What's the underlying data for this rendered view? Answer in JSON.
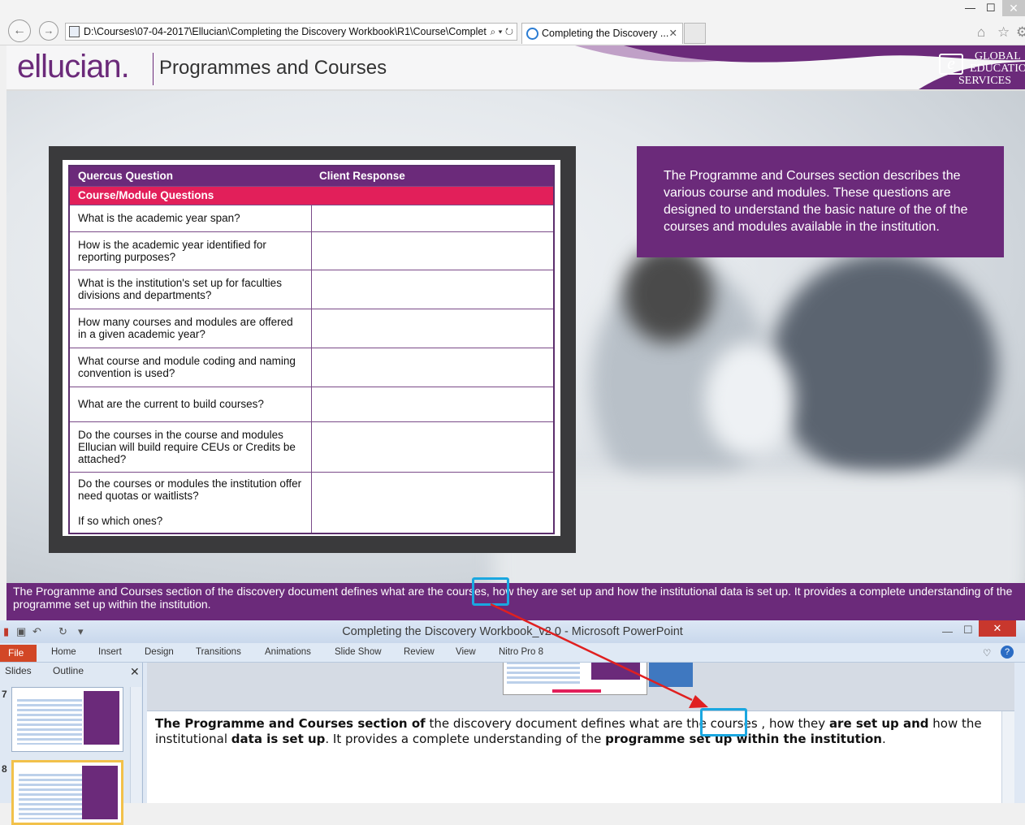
{
  "browser": {
    "address": "D:\\Courses\\07-04-2017\\Ellucian\\Completing the Discovery Workbook\\R1\\Course\\Complet",
    "addr_tools": "⌕ ▾ ↻",
    "tab_title": "Completing the Discovery ...",
    "tab_close": "✕",
    "back": "←",
    "forward": "→",
    "minimize": "—",
    "maximize": "☐",
    "close": "✕",
    "home": "⌂",
    "star": "☆",
    "settings": "⚙"
  },
  "slide": {
    "logo": "ellucian.",
    "title": "Programmes and Courses",
    "partner_logo": {
      "mark": "e",
      "line1": "GLOBAL",
      "line2": "EDUCATIO",
      "line3": "SERVICES"
    }
  },
  "table": {
    "headers": [
      "Quercus Question",
      "Client Response"
    ],
    "category": "Course/Module Questions",
    "rows": [
      {
        "q": "What is the academic year span?",
        "a": ""
      },
      {
        "q": "How is the academic year identified for reporting purposes?",
        "a": ""
      },
      {
        "q": "What is the institution's set up for faculties divisions and departments?",
        "a": ""
      },
      {
        "q": "How many courses and modules are offered in a given academic year?",
        "a": ""
      },
      {
        "q": "What course and module coding and naming convention is used?",
        "a": ""
      },
      {
        "q": "What are the current to build courses?",
        "a": ""
      },
      {
        "q": "Do the courses in the course and modules Ellucian will build require CEUs or Credits be attached?",
        "a": ""
      },
      {
        "q": "Do the courses or modules the institution offer need quotas or waitlists?",
        "q2": "If so which ones?",
        "a": ""
      }
    ]
  },
  "info_box": "The Programme and Courses section describes the various course and modules. These questions are designed to understand the basic nature of the of the courses and modules available in the institution.",
  "caption": "The Programme and Courses section of the discovery document defines what are the courses, how they are set up and how the institutional data is set up. It provides a complete understanding of the programme set up within the institution.",
  "powerpoint": {
    "window_title": "Completing the Discovery Workbook_v2.0 - Microsoft PowerPoint",
    "minimize": "—",
    "maximize": "☐",
    "close": "✕",
    "tabs": [
      "File",
      "Home",
      "Insert",
      "Design",
      "Transitions",
      "Animations",
      "Slide Show",
      "Review",
      "View",
      "Nitro Pro 8"
    ],
    "pane_tabs": [
      "Slides",
      "Outline"
    ],
    "pane_close": "✕",
    "slide_numbers": [
      "7",
      "8"
    ],
    "notes": {
      "p1": "The Programme and Courses section of",
      "p2": " the discovery document defines what are the cou",
      "p3": "rses , ho",
      "p4": "w they ",
      "p5": "are set up and",
      "p6": " how the institutional ",
      "p7": "data is set up",
      "p8": ". It provides a complete understanding of the ",
      "p9": "programme set up within the institution",
      "p10": "."
    }
  },
  "colors": {
    "purple": "#6b2a7a",
    "accent_pink": "#e21f5a",
    "highlight": "#1aa7e0",
    "arrow": "#e02020"
  }
}
